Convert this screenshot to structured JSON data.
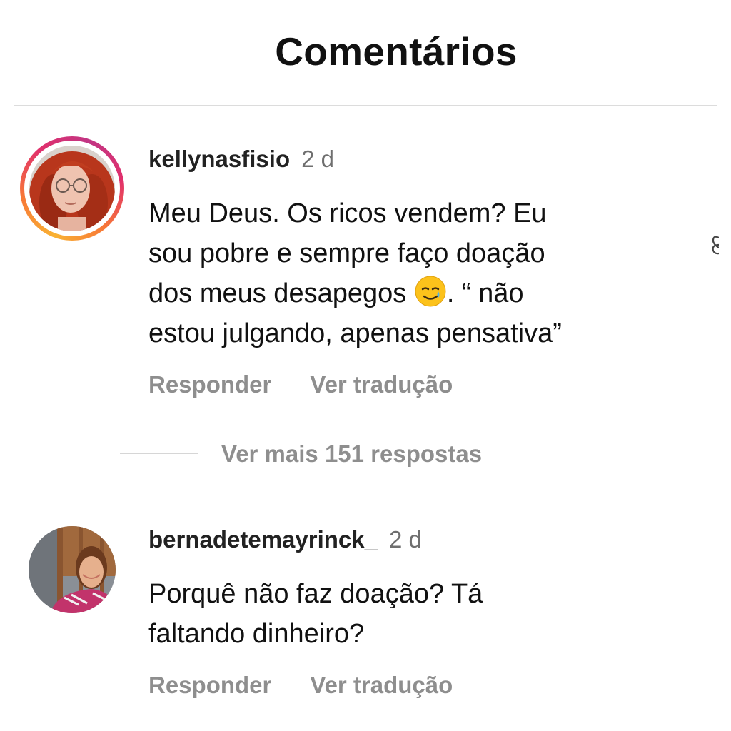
{
  "header": {
    "title": "Comentários"
  },
  "comments": [
    {
      "username": "kellynasfisio",
      "time": "2 d",
      "text_line1": "Meu Deus. Os ricos vendem?  Eu",
      "text_line2": "sou pobre e sempre faço doação",
      "text_line3a": "dos meus desapegos ",
      "text_line3b": ". “ não",
      "text_line4": "estou julgando, apenas pensativa”",
      "emoji": "smiling-face-with-tear-icon",
      "reply_label": "Responder",
      "translate_label": "Ver tradução",
      "has_story_ring": true
    },
    {
      "username": "bernadetemayrinck_",
      "time": "2 d",
      "text_line1": "Porquê não faz doação? Tá",
      "text_line2": "faltando dinheiro?",
      "reply_label": "Responder",
      "translate_label": "Ver tradução",
      "has_story_ring": false
    }
  ],
  "more_replies": {
    "label": "Ver mais 151 respostas"
  },
  "colors": {
    "text": "#111111",
    "muted": "#8e8e8e",
    "divider": "#dcdcdc",
    "ring_start": "#f9b233",
    "ring_end": "#c13584"
  }
}
